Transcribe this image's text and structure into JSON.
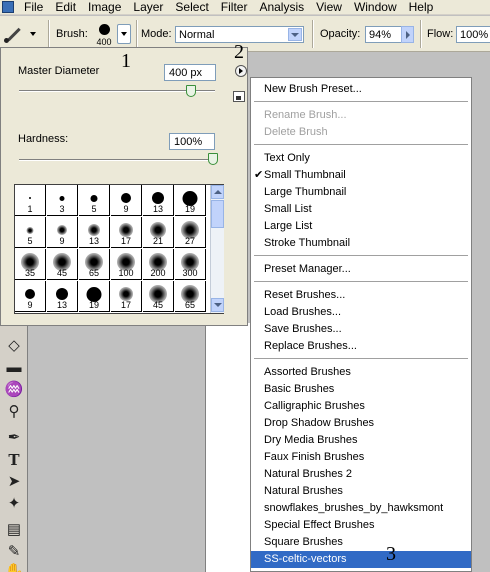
{
  "menubar": {
    "items": [
      "File",
      "Edit",
      "Image",
      "Layer",
      "Select",
      "Filter",
      "Analysis",
      "View",
      "Window",
      "Help"
    ]
  },
  "options": {
    "brush_label": "Brush:",
    "brush_size": "400",
    "mode_label": "Mode:",
    "mode_value": "Normal",
    "opacity_label": "Opacity:",
    "opacity_value": "94%",
    "flow_label": "Flow:",
    "flow_value": "100%"
  },
  "brush_panel": {
    "master_diameter_label": "Master Diameter",
    "master_diameter_value": "400 px",
    "master_diameter_level": 0.88,
    "hardness_label": "Hardness:",
    "hardness_value": "100%",
    "hardness_level": 1.0,
    "presets": [
      {
        "size": "1",
        "soft": false
      },
      {
        "size": "3",
        "soft": false
      },
      {
        "size": "5",
        "soft": false
      },
      {
        "size": "9",
        "soft": false
      },
      {
        "size": "13",
        "soft": false
      },
      {
        "size": "19",
        "soft": false
      },
      {
        "size": "5",
        "soft": true
      },
      {
        "size": "9",
        "soft": true
      },
      {
        "size": "13",
        "soft": true
      },
      {
        "size": "17",
        "soft": true
      },
      {
        "size": "21",
        "soft": true
      },
      {
        "size": "27",
        "soft": true
      },
      {
        "size": "35",
        "soft": true
      },
      {
        "size": "45",
        "soft": true
      },
      {
        "size": "65",
        "soft": true
      },
      {
        "size": "100",
        "soft": true
      },
      {
        "size": "200",
        "soft": true
      },
      {
        "size": "300",
        "soft": true
      },
      {
        "size": "9",
        "soft": false
      },
      {
        "size": "13",
        "soft": false
      },
      {
        "size": "19",
        "soft": false
      },
      {
        "size": "17",
        "soft": true
      },
      {
        "size": "45",
        "soft": true
      },
      {
        "size": "65",
        "soft": true
      }
    ]
  },
  "context_menu": {
    "groups": [
      [
        {
          "label": "New Brush Preset...",
          "disabled": false
        }
      ],
      [
        {
          "label": "Rename Brush...",
          "disabled": true
        },
        {
          "label": "Delete Brush",
          "disabled": true
        }
      ],
      [
        {
          "label": "Text Only"
        },
        {
          "label": "Small Thumbnail",
          "checked": true
        },
        {
          "label": "Large Thumbnail"
        },
        {
          "label": "Small List"
        },
        {
          "label": "Large List"
        },
        {
          "label": "Stroke Thumbnail"
        }
      ],
      [
        {
          "label": "Preset Manager..."
        }
      ],
      [
        {
          "label": "Reset Brushes..."
        },
        {
          "label": "Load Brushes..."
        },
        {
          "label": "Save Brushes..."
        },
        {
          "label": "Replace Brushes..."
        }
      ],
      [
        {
          "label": "Assorted Brushes"
        },
        {
          "label": "Basic Brushes"
        },
        {
          "label": "Calligraphic Brushes"
        },
        {
          "label": "Drop Shadow Brushes"
        },
        {
          "label": "Dry Media Brushes"
        },
        {
          "label": "Faux Finish Brushes"
        },
        {
          "label": "Natural Brushes 2"
        },
        {
          "label": "Natural Brushes"
        },
        {
          "label": "snowflakes_brushes_by_hawksmont"
        },
        {
          "label": "Special Effect Brushes"
        },
        {
          "label": "Square Brushes"
        },
        {
          "label": "SS-celtic-vectors",
          "selected": true
        }
      ]
    ]
  },
  "annotations": {
    "a1": "1",
    "a2": "2",
    "a3": "3"
  }
}
